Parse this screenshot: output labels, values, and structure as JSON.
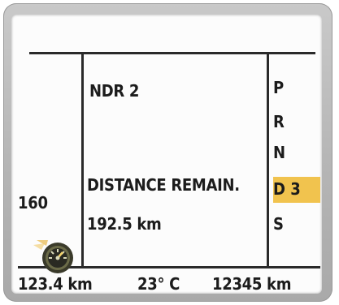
{
  "trip": {
    "radio_station": "NDR 2",
    "distance_label": "DISTANCE REMAIN.",
    "distance_value": "192.5 km"
  },
  "speed": {
    "limit": "160"
  },
  "gear_selector": {
    "gears": [
      "P",
      "R",
      "N",
      "D 3",
      "S"
    ],
    "active": "D 3",
    "active_color": "#f1c34e"
  },
  "status_bar": {
    "trip_distance": "123.4 km",
    "temperature": "23° C",
    "odometer": "12345 km"
  },
  "icons": {
    "speedometer": "speedometer-icon"
  }
}
